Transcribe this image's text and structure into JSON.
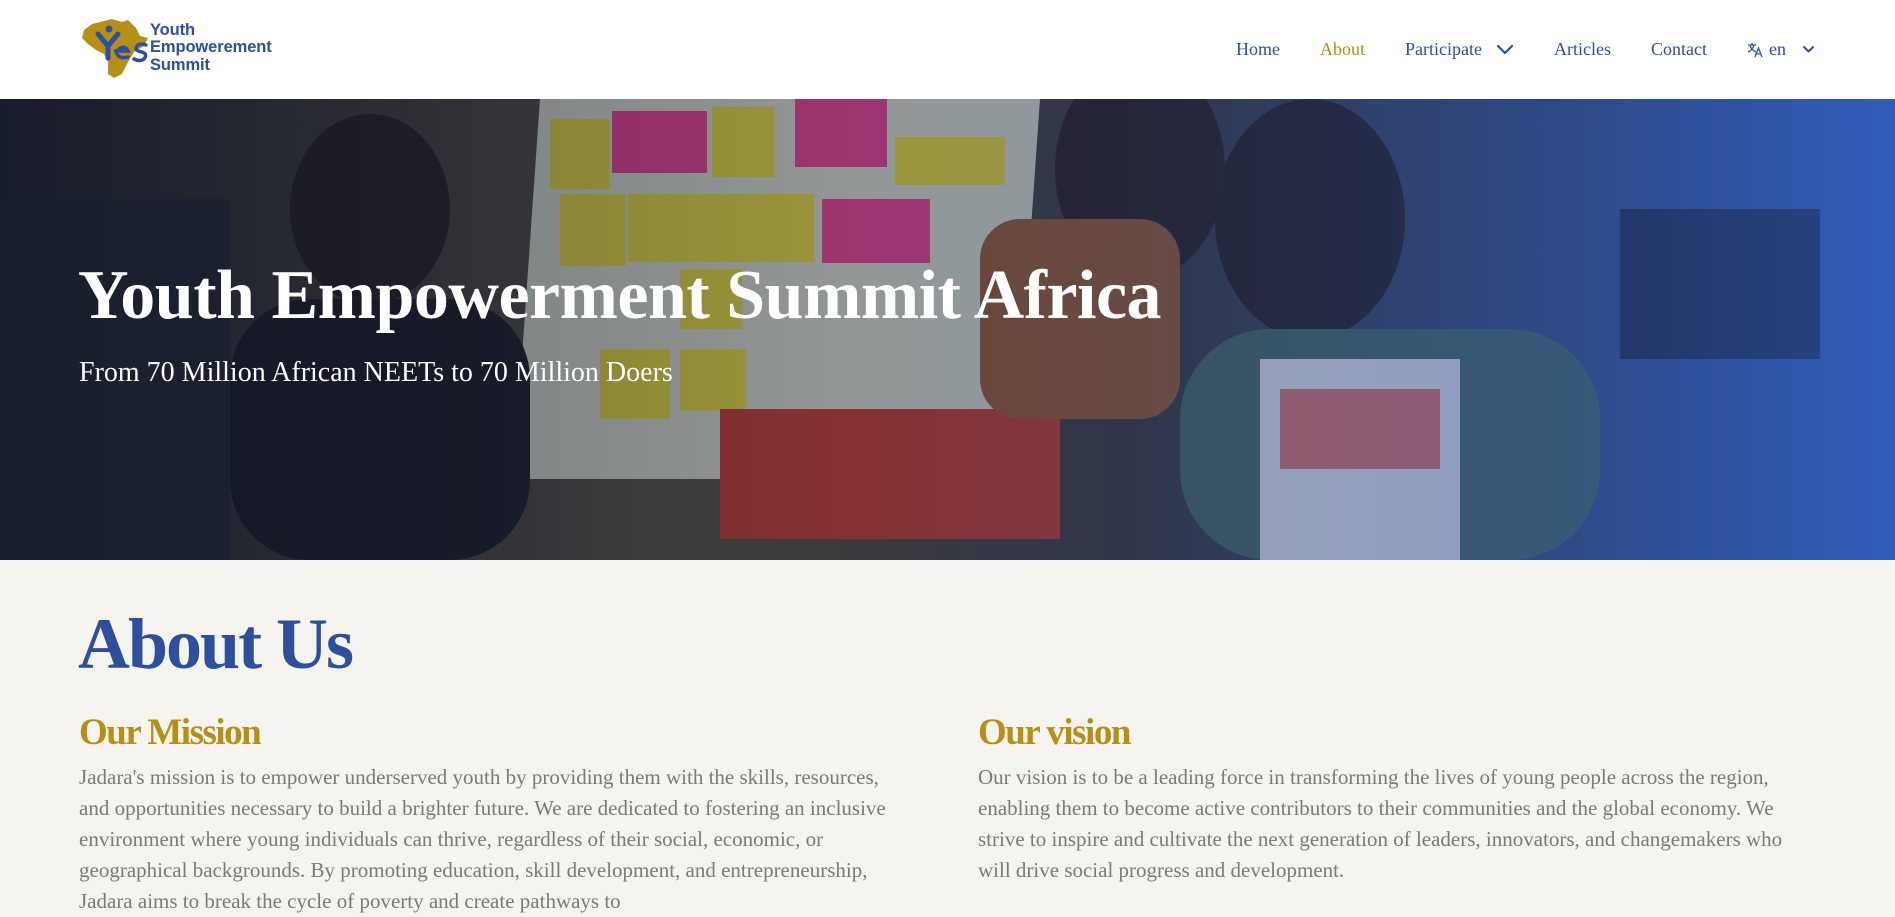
{
  "header": {
    "logo": {
      "mark_text": "YES",
      "line1": "Youth",
      "line2": "Empowerement",
      "line3": "Summit"
    },
    "nav": {
      "home": "Home",
      "about": "About",
      "participate": "Participate",
      "articles": "Articles",
      "contact": "Contact",
      "language": "en"
    }
  },
  "hero": {
    "title": "Youth Empowerment Summit Africa",
    "subtitle": "From 70 Million African NEETs to 70 Million Doers"
  },
  "about": {
    "title": "About Us",
    "mission": {
      "title": "Our Mission",
      "body": "Jadara's mission is to empower underserved youth by providing them with the skills, resources, and opportunities necessary to build a brighter future. We are dedicated to fostering an inclusive environment where young individuals can thrive, regardless of their social, economic, or geographical backgrounds. By promoting education, skill development, and entrepreneurship, Jadara aims to break the cycle of poverty and create pathways to"
    },
    "vision": {
      "title": "Our vision",
      "body": "Our vision is to be a leading force in transforming the lives of young people across the region, enabling them to become active contributors to their communities and the global economy. We strive to inspire and cultivate the next generation of leaders, innovators, and changemakers who will drive social progress and development."
    }
  },
  "colors": {
    "brand_blue": "#2e4f9e",
    "brand_gold": "#b58f17",
    "body_text": "#7a7a7a",
    "page_background": "#f5f4ef"
  },
  "icons": [
    "logo-mark",
    "chevron-down-icon",
    "translate-icon",
    "chevron-down-icon"
  ]
}
